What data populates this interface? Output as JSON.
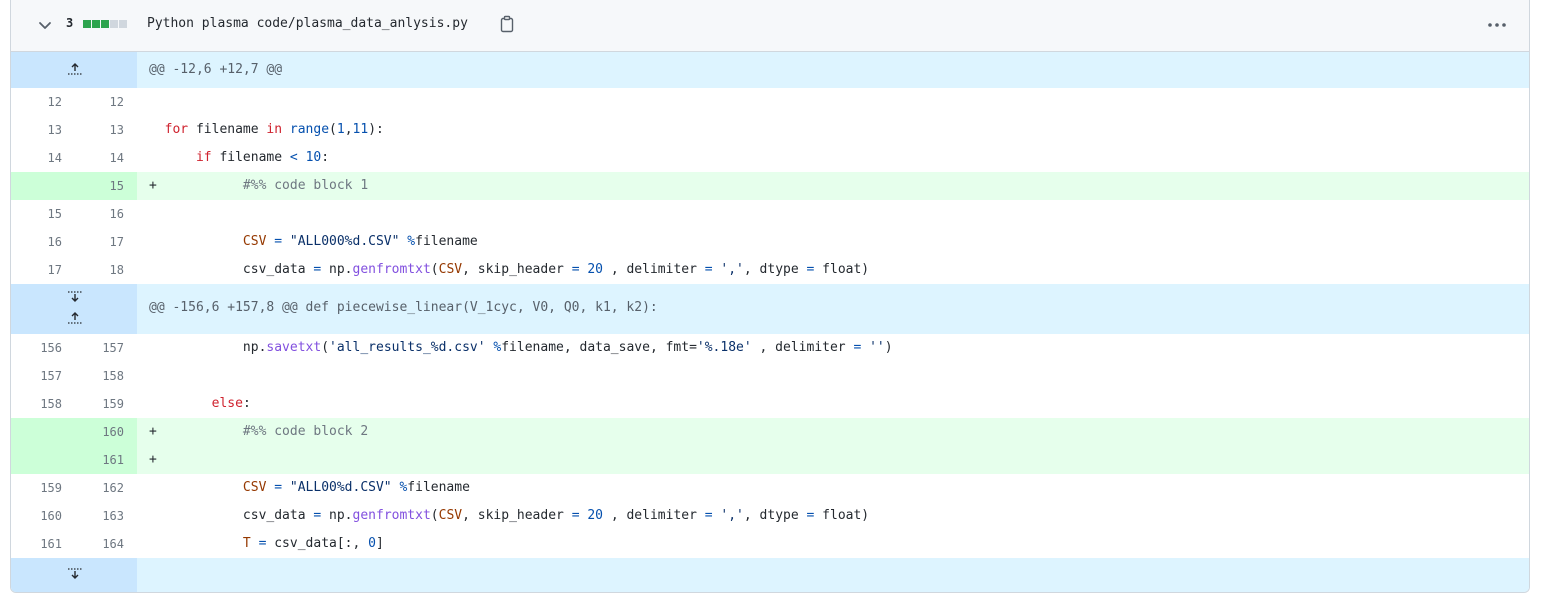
{
  "header": {
    "changes_count": "3",
    "file_path": "Python plasma code/plasma_data_anlysis.py",
    "diffstat": [
      "#2da44e",
      "#2da44e",
      "#2da44e",
      "#d0d7de",
      "#d0d7de"
    ]
  },
  "hunks": {
    "h1": "@@ -12,6 +12,7 @@",
    "h2": "@@ -156,6 +157,8 @@ def piecewise_linear(V_1cyc, V0, Q0, k1, k2):"
  },
  "lines": {
    "l1": {
      "old": "12",
      "new": "12"
    },
    "l2": {
      "old": "13",
      "new": "13"
    },
    "l3": {
      "old": "14",
      "new": "14"
    },
    "l4": {
      "old": "",
      "new": "15",
      "marker": "+"
    },
    "l5": {
      "old": "15",
      "new": "16"
    },
    "l6": {
      "old": "16",
      "new": "17"
    },
    "l7": {
      "old": "17",
      "new": "18"
    },
    "l8": {
      "old": "156",
      "new": "157"
    },
    "l9": {
      "old": "157",
      "new": "158"
    },
    "l10": {
      "old": "158",
      "new": "159"
    },
    "l11": {
      "old": "",
      "new": "160",
      "marker": "+"
    },
    "l12": {
      "old": "",
      "new": "161",
      "marker": "+"
    },
    "l13": {
      "old": "159",
      "new": "162"
    },
    "l14": {
      "old": "160",
      "new": "163"
    },
    "l15": {
      "old": "161",
      "new": "164"
    }
  },
  "code": {
    "t_for": "for",
    "t_filename1": " filename ",
    "t_in": "in",
    "t_range": "range",
    "t_r_args_open": "(",
    "t_1": "1",
    "t_comma": ",",
    "t_11": "11",
    "t_r_close": "):",
    "t_if": "if",
    "t_filename2": " filename ",
    "t_lt": "<",
    "t_10": "10",
    "t_colon": ":",
    "t_comment1": "#%% code block 1",
    "t_csv1": "CSV",
    "t_eq1": "=",
    "t_str1": "\"ALL000%d.CSV\"",
    "t_pct1": "%",
    "t_fn1": "filename",
    "t_csvdata1": "csv_data ",
    "t_eq2": "=",
    "t_np1": " np.",
    "t_genft1": "genfromtxt",
    "t_po1": "(",
    "t_csvarg1": "CSV",
    "t_skip1": ", skip_header ",
    "t_eq3": "=",
    "t_20a": "20",
    "t_delim1": " , delimiter ",
    "t_eq4": "=",
    "t_str2": "','",
    "t_dtype1": ", dtype ",
    "t_eq5": "=",
    "t_float1": " float)",
    "t_np2": "np.",
    "t_savetxt": "savetxt",
    "t_po2": "(",
    "t_str3": "'all_results_%d.csv'",
    "t_pct2": " %",
    "t_sv_rest1": "filename, data_save, fmt=",
    "t_str4": "'%.18e'",
    "t_sv_rest2": " , delimiter ",
    "t_eq6": "=",
    "t_str5": "''",
    "t_pc2": ")",
    "t_else": "else",
    "t_colon2": ":",
    "t_comment2": "#%% code block 2",
    "t_csv2": "CSV",
    "t_eq7": "=",
    "t_str6": "\"ALL00%d.CSV\"",
    "t_pct3": "%",
    "t_fn2": "filename",
    "t_csvdata2": "csv_data ",
    "t_eq8": "=",
    "t_np3": " np.",
    "t_genft2": "genfromtxt",
    "t_po3": "(",
    "t_csvarg2": "CSV",
    "t_skip2": ", skip_header ",
    "t_eq9": "=",
    "t_20b": "20",
    "t_delim2": " , delimiter ",
    "t_eq10": "=",
    "t_str7": "','",
    "t_dtype2": ", dtype ",
    "t_eq11": "=",
    "t_float2": " float)",
    "t_T": "T",
    "t_eq12": "=",
    "t_csvidx": " csv_data[:, ",
    "t_0": "0",
    "t_close": "]"
  },
  "icons": {
    "collapse": "chevron-down-icon",
    "copy": "copy-icon",
    "menu": "kebab-horizontal-icon",
    "expand_up": "unfold-up-icon",
    "expand_down": "unfold-down-icon"
  }
}
